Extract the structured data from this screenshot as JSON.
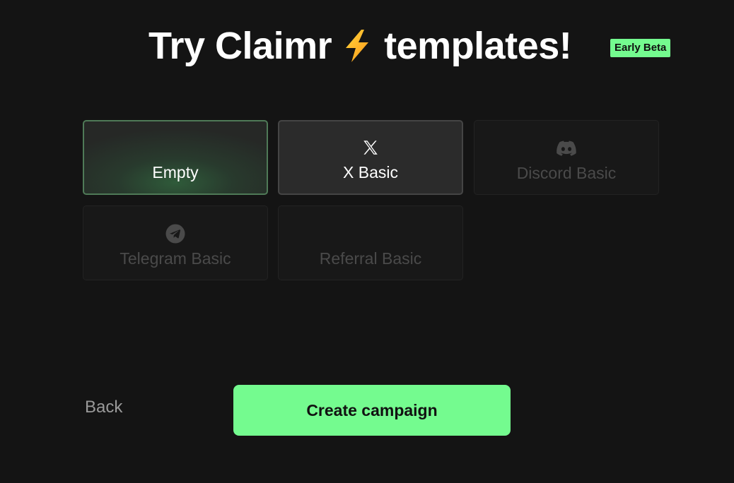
{
  "header": {
    "title_before": "Try Claimr",
    "title_after": "templates!",
    "bolt_icon": "lightning-bolt-icon",
    "badge": "Early Beta"
  },
  "templates": [
    {
      "label": "Empty",
      "icon": "",
      "state": "selected"
    },
    {
      "label": "X Basic",
      "icon": "x-logo-icon",
      "state": "enabled"
    },
    {
      "label": "Discord Basic",
      "icon": "discord-icon",
      "state": "disabled"
    },
    {
      "label": "Telegram Basic",
      "icon": "telegram-icon",
      "state": "disabled"
    },
    {
      "label": "Referral Basic",
      "icon": "",
      "state": "disabled"
    }
  ],
  "footer": {
    "back_label": "Back",
    "create_label": "Create campaign"
  },
  "colors": {
    "background": "#141414",
    "accent": "#74fb8f",
    "selected_border": "#4f7a57",
    "disabled_text": "#4a4a4a"
  }
}
